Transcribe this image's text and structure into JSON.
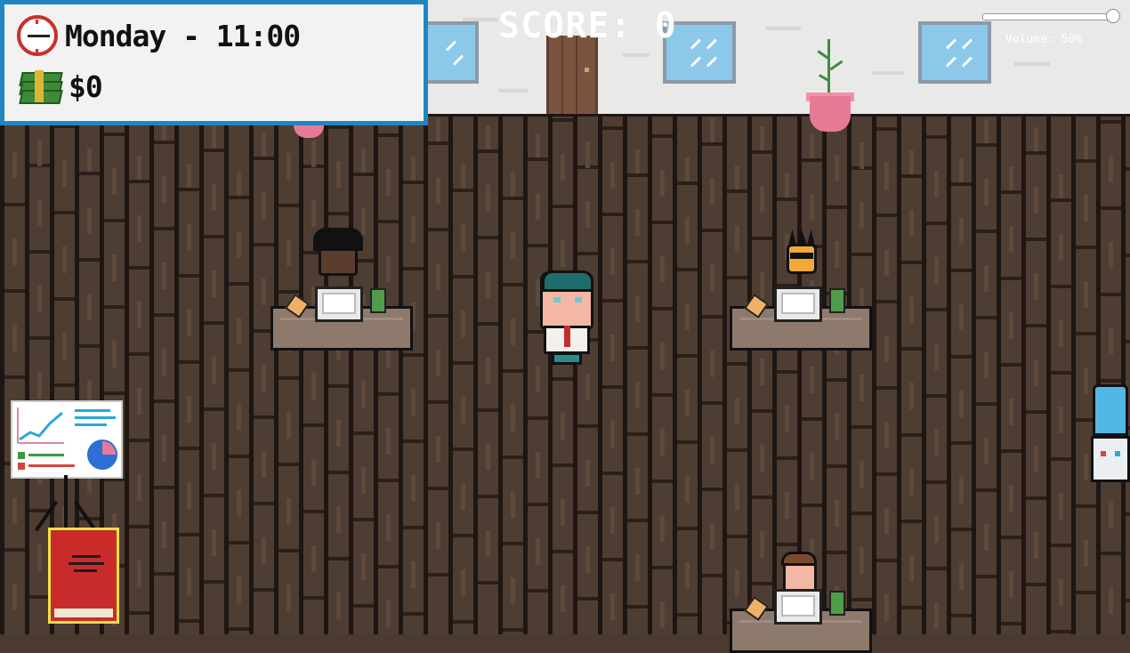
{
  "hud": {
    "time_label": "Monday - 11:00",
    "money_label": "$0",
    "icons": [
      "clock-icon",
      "money-stack-icon"
    ]
  },
  "score": {
    "label": "SCORE: 0"
  },
  "volume": {
    "label": "Volume: 50%",
    "level": 0.96
  },
  "scene": {
    "sprites": [
      "office-wall",
      "door",
      "windows",
      "potted-plant",
      "desks",
      "coworkers",
      "player-boss",
      "whiteboard-chart",
      "red-book",
      "water-cooler"
    ]
  },
  "colors": {
    "hud_border": "#1f86c2",
    "floor": "#4e3d33",
    "wall": "#e9e9e7",
    "accent_red": "#c92b2b",
    "book_border": "#f3e04a"
  }
}
